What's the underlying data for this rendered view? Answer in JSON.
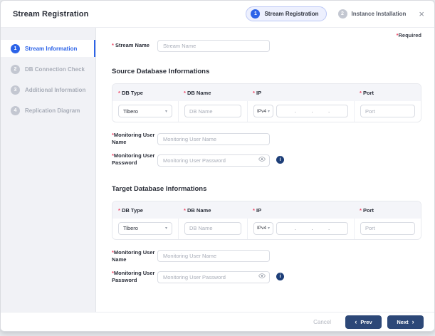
{
  "colors": {
    "primary_blue": "#2c63e8",
    "navy_button": "#2d4878",
    "required_red": "#ef4565",
    "sidebar_bg": "#f1f2f6",
    "table_head_bg": "#f4f5f9"
  },
  "header": {
    "title": "Stream Registration",
    "close_icon": "×",
    "steps": [
      {
        "number": "1",
        "label": "Stream Registration"
      },
      {
        "number": "2",
        "label": "Instance Installation"
      }
    ]
  },
  "required_note": {
    "asterisk": "*",
    "label": "Required"
  },
  "sidebar": {
    "items": [
      {
        "number": "1",
        "label": "Stream Information"
      },
      {
        "number": "2",
        "label": "DB Connection Check"
      },
      {
        "number": "3",
        "label": "Additional Information"
      },
      {
        "number": "4",
        "label": "Replication Diagram"
      }
    ]
  },
  "stream_name": {
    "label": "Stream Name",
    "placeholder": "Stream Name"
  },
  "sections": {
    "source": {
      "title": "Source Database Informations",
      "columns": [
        "DB Type",
        "DB Name",
        "IP",
        "Port"
      ],
      "db_type_value": "Tibero",
      "db_name_placeholder": "DB Name",
      "ip_version": "IPv4",
      "ip_dot": ".",
      "port_placeholder": "Port",
      "monitoring_name": {
        "label": "Monitoring User Name",
        "placeholder": "Monitoring User Name"
      },
      "monitoring_password": {
        "label": "Monitoring User Password",
        "placeholder": "Monitoring User Password",
        "info_icon": "i"
      }
    },
    "target": {
      "title": "Target Database Informations",
      "columns": [
        "DB Type",
        "DB Name",
        "IP",
        "Port"
      ],
      "db_type_value": "Tibero",
      "db_name_placeholder": "DB Name",
      "ip_version": "IPv4",
      "ip_dot": ".",
      "port_placeholder": "Port",
      "monitoring_name": {
        "label": "Monitoring User Name",
        "placeholder": "Monitoring User Name"
      },
      "monitoring_password": {
        "label": "Monitoring User Password",
        "placeholder": "Monitoring User Password",
        "info_icon": "i"
      }
    }
  },
  "select_chevron": "▾",
  "footer": {
    "cancel_label": "Cancel",
    "prev_label": "Prev",
    "next_label": "Next",
    "prev_icon": "‹",
    "next_icon": "›"
  }
}
